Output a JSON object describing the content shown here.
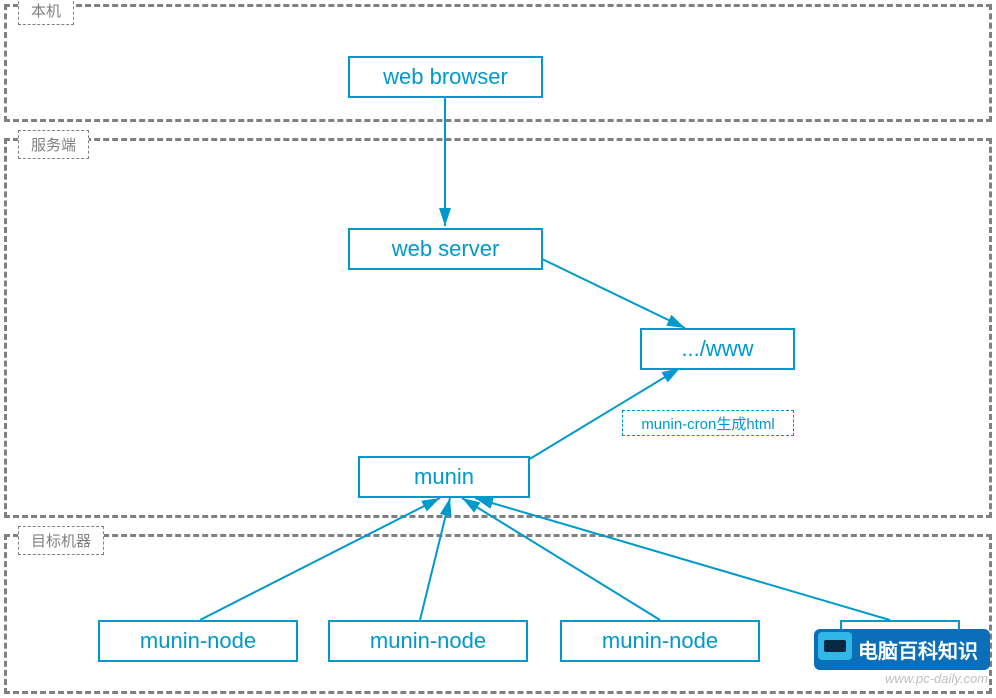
{
  "zones": {
    "local": {
      "label": "本机"
    },
    "server": {
      "label": "服务端"
    },
    "target": {
      "label": "目标机器"
    }
  },
  "nodes": {
    "browser": {
      "label": "web browser"
    },
    "webserver": {
      "label": "web server"
    },
    "www": {
      "label": ".../www"
    },
    "munin": {
      "label": "munin"
    },
    "node1": {
      "label": "munin-node"
    },
    "node2": {
      "label": "munin-node"
    },
    "node3": {
      "label": "munin-node"
    },
    "node4": {
      "label": "..."
    }
  },
  "notes": {
    "cron": {
      "label": "munin-cron生成html"
    }
  },
  "watermark": {
    "title": "电脑百科知识",
    "url": "www.pc-daily.com"
  },
  "colors": {
    "accent": "#0099cc",
    "zone_border": "#808080"
  }
}
